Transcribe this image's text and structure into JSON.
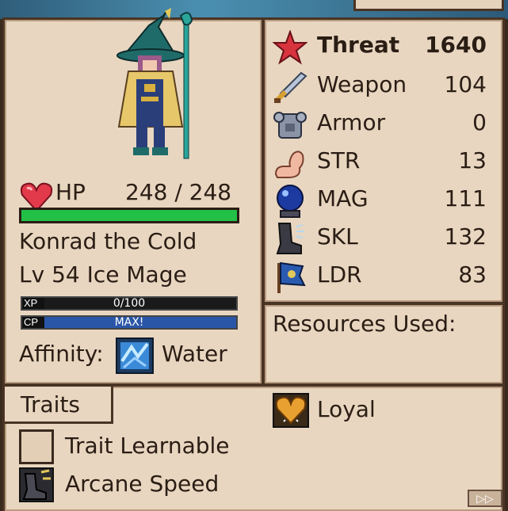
{
  "unit": {
    "name": "Konrad the Cold",
    "level_class": "Lv 54 Ice Mage",
    "hp_label": "HP",
    "hp_value": "248 / 248",
    "hp_fraction": 1.0,
    "xp_tag": "XP",
    "xp_value": "0/100",
    "xp_fraction": 0.0,
    "cp_tag": "CP",
    "cp_value": "MAX!",
    "cp_fraction": 1.0,
    "affinity_label": "Affinity:",
    "affinity_value": "Water"
  },
  "stats": {
    "threat": {
      "label": "Threat",
      "value": "1640",
      "icon": "star-icon"
    },
    "rows": [
      {
        "label": "Weapon",
        "value": "104",
        "icon": "sword-icon"
      },
      {
        "label": "Armor",
        "value": "0",
        "icon": "armor-icon"
      },
      {
        "label": "STR",
        "value": "13",
        "icon": "flexed-arm-icon"
      },
      {
        "label": "MAG",
        "value": "111",
        "icon": "crystal-ball-icon"
      },
      {
        "label": "SKL",
        "value": "132",
        "icon": "boot-icon"
      },
      {
        "label": "LDR",
        "value": "83",
        "icon": "banner-icon"
      }
    ]
  },
  "resources": {
    "label": "Resources Used:"
  },
  "traits": {
    "tab_label": "Traits",
    "items": [
      {
        "label": "Trait Learnable",
        "icon": "empty-slot-icon"
      },
      {
        "label": "Arcane Speed",
        "icon": "arcane-speed-icon"
      },
      {
        "label": "Loyal",
        "icon": "heart-icon"
      }
    ]
  },
  "nav": {
    "fast_forward": "▷▷"
  },
  "colors": {
    "hp_bar": "#22c046",
    "cp_bar": "#2a56a8",
    "panel": "#e8d6c0",
    "border": "#4a3424"
  }
}
